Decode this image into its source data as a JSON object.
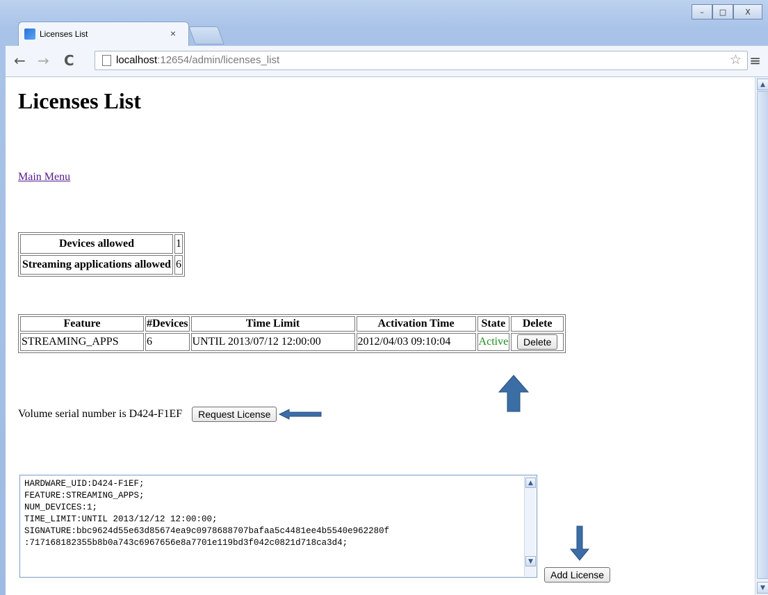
{
  "browser": {
    "tab_title": "Licenses List",
    "tab_close": "×",
    "url_host": "localhost",
    "url_rest": ":12654/admin/licenses_list",
    "back_glyph": "←",
    "forward_glyph": "→",
    "reload_glyph": "C",
    "star_glyph": "☆",
    "menu_glyph": "≡",
    "minimize_glyph": "–",
    "maximize_glyph": "□",
    "close_glyph": "X"
  },
  "page": {
    "title": "Licenses List",
    "main_menu_link": "Main Menu",
    "summary": [
      {
        "label": "Devices allowed",
        "value": "1"
      },
      {
        "label": "Streaming applications allowed",
        "value": "6"
      }
    ],
    "licenses": {
      "headers": [
        "Feature",
        "#Devices",
        "Time Limit",
        "Activation Time",
        "State",
        "Delete"
      ],
      "rows": [
        {
          "feature": "STREAMING_APPS",
          "devices": "6",
          "time_limit": "UNTIL 2013/07/12 12:00:00",
          "activation_time": "2012/04/03 09:10:04",
          "state": "Active",
          "delete_label": "Delete"
        }
      ]
    },
    "volume_text": "Volume serial number is D424-F1EF",
    "request_button": "Request License",
    "license_text": "HARDWARE_UID:D424-F1EF;\nFEATURE:STREAMING_APPS;\nNUM_DEVICES:1;\nTIME_LIMIT:UNTIL 2013/12/12 12:00:00;\nSIGNATURE:bbc9624d55e63d85674ea9c0978688707bafaa5c4481ee4b5540e962280f\n:717168182355b8b0a743c6967656e8a7701e119bd3f042c0821d718ca3d4;",
    "add_button": "Add License",
    "annotation_color": "#3b6ea5"
  }
}
